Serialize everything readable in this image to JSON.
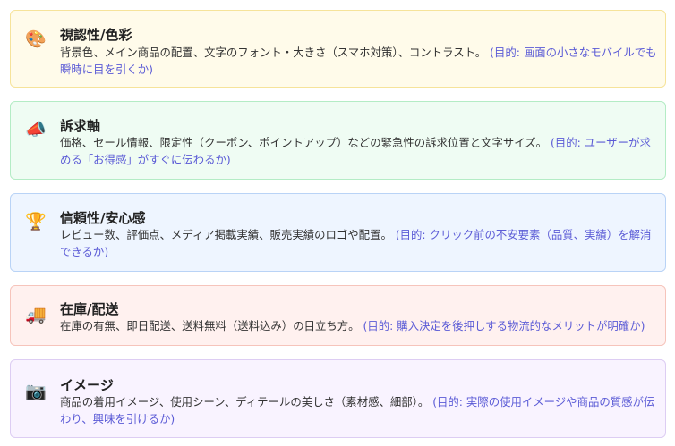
{
  "cards": [
    {
      "icon": "palette-icon",
      "icon_glyph": "🎨",
      "title": "視認性/色彩",
      "description": "背景色、メイン商品の配置、文字のフォント・大きさ（スマホ対策）、コントラスト。",
      "purpose": "(目的: 画面の小さなモバイルでも瞬時に目を引くか)",
      "bg": "#fffbea",
      "border": "#f6e39a"
    },
    {
      "icon": "megaphone-icon",
      "icon_glyph": "📣",
      "title": "訴求軸",
      "description": "価格、セール情報、限定性（クーポン、ポイントアップ）などの緊急性の訴求位置と文字サイズ。",
      "purpose": "(目的: ユーザーが求める「お得感」がすぐに伝わるか)",
      "bg": "#effcf3",
      "border": "#b4ecc5"
    },
    {
      "icon": "trophy-icon",
      "icon_glyph": "🏆",
      "title": "信頼性/安心感",
      "description": "レビュー数、評価点、メディア掲載実績、販売実績のロゴや配置。",
      "purpose": "(目的: クリック前の不安要素（品質、実績）を解消できるか)",
      "bg": "#eef5ff",
      "border": "#b9d3f6"
    },
    {
      "icon": "delivery-truck-icon",
      "icon_glyph": "🚚",
      "title": "在庫/配送",
      "description": "在庫の有無、即日配送、送料無料（送料込み）の目立ち方。",
      "purpose": "(目的: 購入決定を後押しする物流的なメリットが明確か)",
      "bg": "#fff1ef",
      "border": "#f6c4bb"
    },
    {
      "icon": "camera-icon",
      "icon_glyph": "📷",
      "title": "イメージ",
      "description": "商品の着用イメージ、使用シーン、ディテールの美しさ（素材感、細部）。",
      "purpose": "(目的: 実際の使用イメージや商品の質感が伝わり、興味を引けるか)",
      "bg": "#f9f3ff",
      "border": "#ddcdf3"
    }
  ]
}
